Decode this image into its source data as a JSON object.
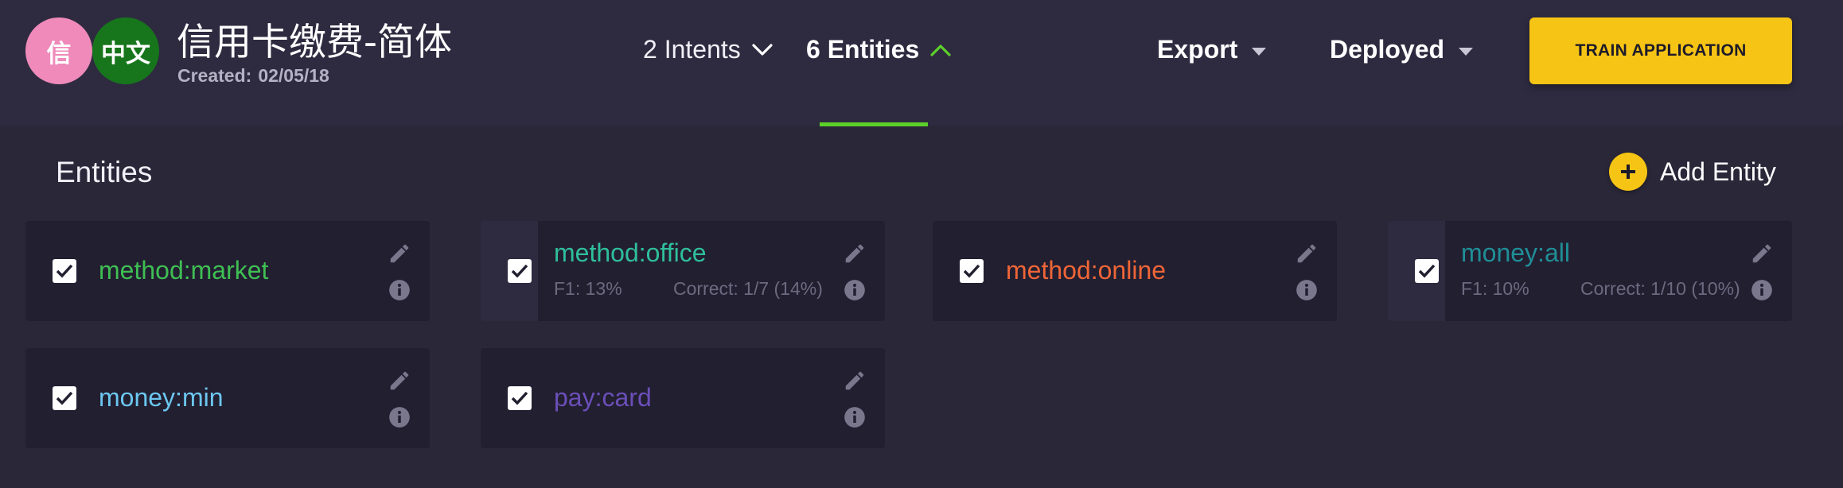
{
  "app": {
    "avatars": [
      "信",
      "中文"
    ],
    "title": "信用卡缴费-简体",
    "created_label": "Created:",
    "created_date": "02/05/18"
  },
  "nav": {
    "intents_label": "2 Intents",
    "entities_label": "6 Entities"
  },
  "actions": {
    "export_label": "Export",
    "deployed_label": "Deployed",
    "train_label": "TRAIN APPLICATION"
  },
  "section": {
    "title": "Entities",
    "add_label": "Add Entity"
  },
  "entities": [
    {
      "name": "method:market",
      "color": "#3fbf53",
      "checked": true
    },
    {
      "name": "method:office",
      "color": "#2fbf9a",
      "checked": true,
      "f1": "F1: 13%",
      "correct": "Correct: 1/7 (14%)"
    },
    {
      "name": "method:online",
      "color": "#ef6537",
      "checked": true
    },
    {
      "name": "money:all",
      "color": "#1f8f97",
      "checked": true,
      "f1": "F1: 10%",
      "correct": "Correct: 1/10 (10%)"
    },
    {
      "name": "money:min",
      "color": "#6cc7ef",
      "checked": true
    },
    {
      "name": "pay:card",
      "color": "#6b4fb8",
      "checked": true
    }
  ],
  "icons": {
    "edit": "pencil-icon",
    "info": "info-icon",
    "check": "checkmark-icon",
    "intents_chevron": "chevron-down-icon",
    "entities_chevron": "chevron-up-icon",
    "add": "plus-icon"
  },
  "colors": {
    "accent": "#f6c414",
    "active_tab": "#5dd02a",
    "background": "#2a2739",
    "card": "#221f31"
  }
}
